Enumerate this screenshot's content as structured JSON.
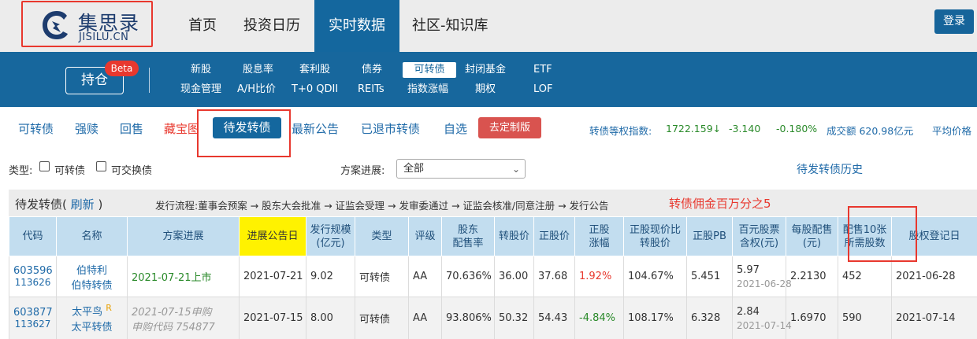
{
  "brand": {
    "name_cn": "集思录",
    "name_en": "JISILU.CN"
  },
  "topnav": {
    "items": [
      "首页",
      "投资日历",
      "实时数据",
      "社区-知识库"
    ],
    "active": "实时数据",
    "login": "登录"
  },
  "subnav": {
    "holdings": "持仓",
    "beta": "Beta",
    "row1": [
      "新股",
      "股息率",
      "套利股",
      "债券",
      "可转债",
      "封闭基金",
      "ETF"
    ],
    "row2": [
      "现金管理",
      "A/H比价",
      "T+0 QDII",
      "REITs",
      "指数涨幅",
      "期权",
      "LOF"
    ],
    "active": "可转债"
  },
  "tabs": {
    "items": [
      "可转债",
      "强赎",
      "回售",
      "藏宝图",
      "待发转债",
      "最新公告",
      "已退市转债",
      "自选"
    ],
    "active": "待发转债",
    "custom_button": "去定制版"
  },
  "stats": {
    "index_label": "转债等权指数:",
    "index_value": "1722.159↓",
    "change": "-3.140",
    "change_pct": "-0.180%",
    "volume": "成交额 620.98亿元",
    "avg_price": "平均价格"
  },
  "filters": {
    "type_label": "类型:",
    "opt1": "可转债",
    "opt2": "可交换债",
    "progress_label": "方案进展:",
    "progress_value": "全部",
    "history_link": "待发转债历史"
  },
  "section": {
    "title": "待发转债(",
    "refresh": "刷新",
    "title_end": ")",
    "flow": "发行流程:董事会预案 → 股东大会批准 → 证监会受理 → 发审委通过 → 证监会核准/同意注册 → 发行公告",
    "flow_note": "转债佣金百万分之5"
  },
  "table": {
    "headers": [
      "代码",
      "名称",
      "方案进展",
      "进展公告日",
      "发行规模\n(亿元)",
      "类型",
      "评级",
      "股东\n配售率",
      "转股价",
      "正股价",
      "正股\n涨幅",
      "正股现价比\n转股价",
      "正股PB",
      "百元股票\n含权(元)",
      "每股配售\n(元)",
      "配售10张\n所需股数",
      "股权登记日"
    ],
    "rows": [
      {
        "code": "603596",
        "bond_code": "113626",
        "name": "伯特利",
        "bond_name": "伯特转债",
        "rating_mark": "",
        "progress": "2021-07-21上市",
        "progress_sub": "",
        "announce": "2021-07-21",
        "size": "9.02",
        "type": "可转债",
        "rating": "AA",
        "placement": "70.636%",
        "conv_price": "36.00",
        "stock_price": "37.68",
        "stock_chg": "1.92%",
        "ratio": "104.67%",
        "pb": "5.451",
        "rights": "5.97",
        "rights_date": "2021-06-28",
        "per_share": "2.2130",
        "shares_needed": "452",
        "record_date": "2021-06-28"
      },
      {
        "code": "603877",
        "bond_code": "113627",
        "name": "太平鸟",
        "bond_name": "太平转债",
        "rating_mark": "R",
        "progress": "2021-07-15申购",
        "progress_sub": "申购代码 754877",
        "announce": "2021-07-15",
        "size": "8.00",
        "type": "可转债",
        "rating": "AA",
        "placement": "93.806%",
        "conv_price": "50.32",
        "stock_price": "54.43",
        "stock_chg": "-4.84%",
        "ratio": "108.17%",
        "pb": "6.328",
        "rights": "2.84",
        "rights_date": "2021-07-14",
        "per_share": "1.6970",
        "shares_needed": "590",
        "record_date": "2021-07-14"
      }
    ]
  },
  "colors": {
    "primary": "#17679d",
    "accent_red": "#e8382e",
    "header_bg": "#c2ddef",
    "highlight_yellow": "#fff200",
    "up_red": "#e8382e",
    "down_green": "#2a8a2a"
  }
}
